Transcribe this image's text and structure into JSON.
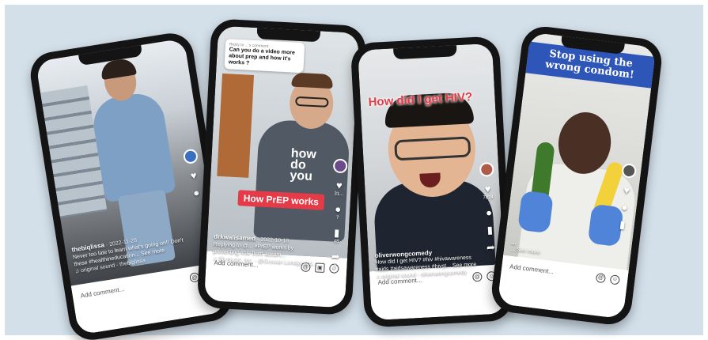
{
  "phones": [
    {
      "username": "thebiqlissa",
      "date": "2022-11-28",
      "caption": "Never too late to learn what's going on!! Don't these #healthineducation... See more",
      "sound": "original sound - thebiglissa",
      "comment_placeholder": "Add comment...",
      "icons": {
        "heart": "heart-icon",
        "comment": "comment-icon",
        "share": "share-icon",
        "at": "at-icon",
        "gift": "gift-icon"
      }
    },
    {
      "question_user": "Reply to ...'s comment",
      "question": "Can you do a video more about prep and how it's works ?",
      "shirt_text": "how do you",
      "overlay": "How PrEP works",
      "likes": "31...",
      "comments": "7",
      "bookmarks": "48",
      "shares": "5",
      "username": "drkwalisamed",
      "date": "2022-10-18",
      "caption": "Replying to @... #PrEP works by preventing #hiv from accum...",
      "sound": "Sb music. Inc. - @Gussan Lundgren &...",
      "comment_placeholder": "Add comment..."
    },
    {
      "overlay": "How did I get HIV?",
      "likes": "7024",
      "comments": "...",
      "bookmarks": "...",
      "shares": "...",
      "username": "oliverwongcomedy",
      "caption": "How did I get HIV? #hiv #hivawareness #aids #aidsawareness #hivst... See more",
      "sound": "original sound - oliverwongcomedy",
      "comment_placeholder": "Add comment..."
    },
    {
      "banner": "Stop using the wrong condom!",
      "username": "...",
      "caption": "... See more",
      "comment_placeholder": "Add comment..."
    }
  ],
  "colors": {
    "background": "#d3e0ea",
    "tiktok_red": "#e53a48",
    "banner_blue": "#2e55b8"
  }
}
